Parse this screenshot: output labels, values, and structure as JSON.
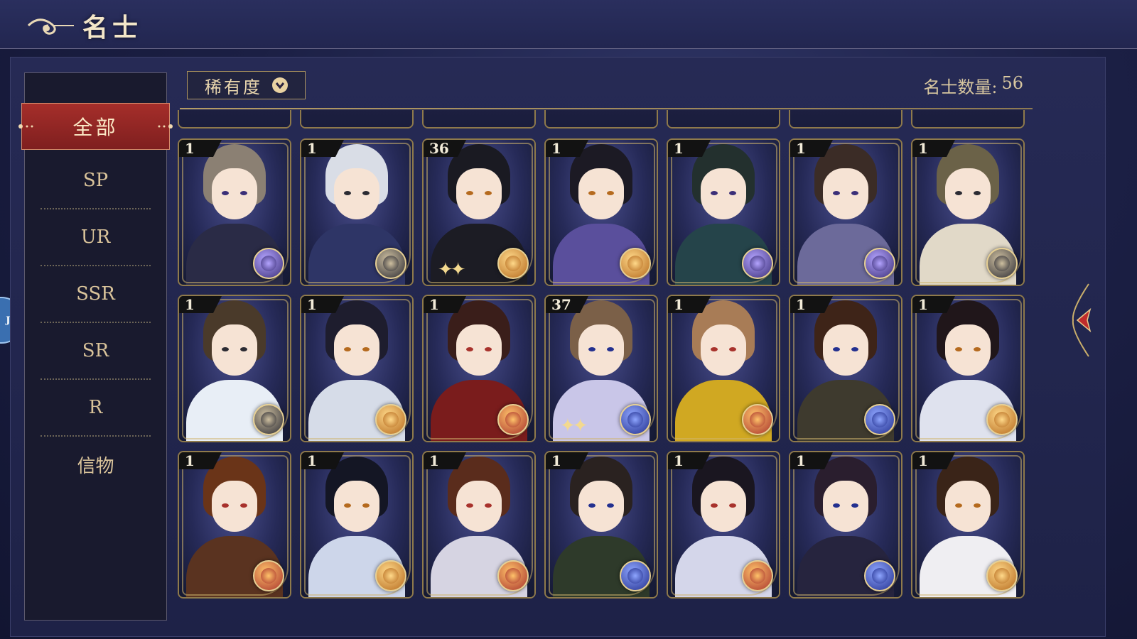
{
  "header": {
    "title": "名士"
  },
  "side_tab": {
    "label": "Ju"
  },
  "categories": [
    {
      "label": "全部",
      "active": true
    },
    {
      "label": "SP"
    },
    {
      "label": "UR"
    },
    {
      "label": "SSR"
    },
    {
      "label": "SR"
    },
    {
      "label": "R"
    },
    {
      "label": "信物"
    }
  ],
  "filter": {
    "label": "稀有度"
  },
  "count": {
    "label": "名士数量:",
    "value": "56"
  },
  "rows": [
    [
      {
        "level": "1",
        "element": "moon-purple",
        "hair": "#8b8073",
        "outfit": "#2a2b46"
      },
      {
        "level": "1",
        "element": "plate-dark",
        "hair": "#d9dde6",
        "outfit": "#2e3566"
      },
      {
        "level": "36",
        "element": "sun-gold",
        "hair": "#1a1a22",
        "outfit": "#1c1c24",
        "stars": true
      },
      {
        "level": "1",
        "element": "sun-gold",
        "hair": "#1c1a24",
        "outfit": "#5a4f9c"
      },
      {
        "level": "1",
        "element": "moon-purple",
        "hair": "#23302e",
        "outfit": "#25444a"
      },
      {
        "level": "1",
        "element": "moon-purple",
        "hair": "#3b2c26",
        "outfit": "#6c6a9a"
      },
      {
        "level": "1",
        "element": "plate-dark",
        "hair": "#6b6248",
        "outfit": "#e1d9c8"
      }
    ],
    [
      {
        "level": "1",
        "element": "plate-dark",
        "hair": "#4a3a2a",
        "outfit": "#e8eef6"
      },
      {
        "level": "1",
        "element": "sun-gold",
        "hair": "#1e1d2e",
        "outfit": "#d6dce8"
      },
      {
        "level": "1",
        "element": "planet-red",
        "hair": "#3a1e1a",
        "outfit": "#7a1c1c"
      },
      {
        "level": "37",
        "element": "planet-blue",
        "hair": "#7b6048",
        "outfit": "#c9c6e8",
        "stars": true
      },
      {
        "level": "1",
        "element": "planet-red",
        "hair": "#a87c56",
        "outfit": "#d0a822"
      },
      {
        "level": "1",
        "element": "planet-blue",
        "hair": "#3e2418",
        "outfit": "#3e3a2e"
      },
      {
        "level": "1",
        "element": "sun-gold",
        "hair": "#20161a",
        "outfit": "#dfe2ee"
      }
    ],
    [
      {
        "level": "1",
        "element": "planet-red",
        "hair": "#6a3418",
        "outfit": "#5a3320"
      },
      {
        "level": "1",
        "element": "sun-gold",
        "hair": "#141624",
        "outfit": "#cdd6ea"
      },
      {
        "level": "1",
        "element": "planet-red",
        "hair": "#5a2c1c",
        "outfit": "#d6d4e2"
      },
      {
        "level": "1",
        "element": "planet-blue",
        "hair": "#2a2220",
        "outfit": "#2e3a2a"
      },
      {
        "level": "1",
        "element": "planet-red",
        "hair": "#1a1620",
        "outfit": "#d4d6ea"
      },
      {
        "level": "1",
        "element": "planet-blue",
        "hair": "#2a1e2e",
        "outfit": "#26243e"
      },
      {
        "level": "1",
        "element": "sun-gold",
        "hair": "#3a2418",
        "outfit": "#efeef2"
      }
    ]
  ],
  "colors": {
    "accent_red": "#a52e2a",
    "gold": "#b59c66",
    "text_gold": "#d9c39a"
  }
}
